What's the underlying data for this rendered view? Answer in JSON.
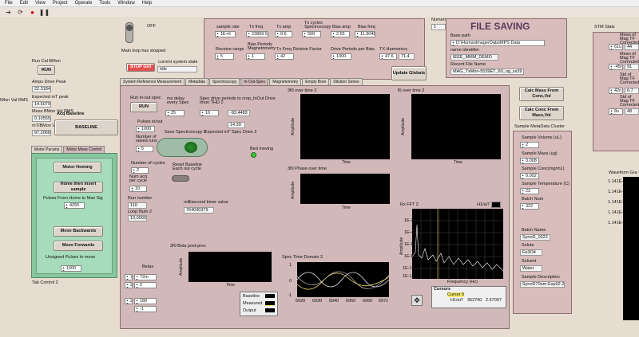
{
  "menu": [
    "File",
    "Edit",
    "View",
    "Project",
    "Operate",
    "Tools",
    "Window",
    "Help"
  ],
  "icons": [
    "run-arrow-icon",
    "run-continuous-icon",
    "abort-icon",
    "pause-icon"
  ],
  "off_label": "OFF",
  "main_loop": "Main loop has stopped",
  "stop_gui": "STOP GUI",
  "system_state": {
    "label": "current system state",
    "value": "Idle"
  },
  "numeric_tiny": {
    "label": "Numeric",
    "value": "1"
  },
  "left": {
    "run_cal_label": "Run Cal BMon",
    "run_label": "RUN",
    "amps_drive_peak": {
      "label": "Amps Drive Peak",
      "value": "22.3184"
    },
    "expected_mt_peak": {
      "label": "Expected mT peak",
      "value": "14.5079"
    },
    "imon_rms": "IMon Val RMS",
    "meas_bmon": {
      "label": "Meas BMon Val RMS",
      "value": "0.10555"
    },
    "mt_bmon": {
      "label": "mT/BMon Val",
      "value": "97.2068"
    },
    "acq_baseline": "Acq Baseline",
    "baseline_btn": "BASELINE"
  },
  "motor": {
    "tabs": [
      "Motor Params",
      "Motor Move Control"
    ],
    "homing": "Motor Homing",
    "home_insert": "Home then insert sample",
    "pulses_label": "Pulses From Home to Max Sig",
    "pulses_value": "4255",
    "move_back": "Move Backwards",
    "move_fwd": "Move Forwards",
    "unsigned_label": "Unsigned Pulses to move",
    "unsigned_value": "1000",
    "tab_control": "Tab Control 2"
  },
  "params": {
    "sample_rate": {
      "label": "sample rate",
      "value": "1E+6"
    },
    "tx_freq": {
      "label": "Tx freq",
      "value": "23809.5"
    },
    "tx_amp": {
      "label": "Tx amp",
      "value": "0.6"
    },
    "tx_cycles": {
      "label": "Tx cycles Spectroscopy",
      "value": "500"
    },
    "bias_amp": {
      "label": "Bias amp",
      "value": "2.65"
    },
    "bias_freq": {
      "label": "Bias freq",
      "value": "11.9048"
    },
    "receive_range": {
      "label": "Receive range",
      "value": "5"
    },
    "bias_periods": {
      "label": "Bias Periods Magnetometry",
      "value": "1"
    },
    "tx_div": {
      "label": "Tx Freq Division Factor",
      "value": "42"
    },
    "drive_periods": {
      "label": "Drive Periods per Bias",
      "value": "1000"
    },
    "tx_harmonics": {
      "label": "TX Harmonics",
      "v1": "47.6",
      "v2": "71.4"
    }
  },
  "file_saving": {
    "title": "FILE SAVING",
    "base_path": {
      "label": "Base path",
      "value": "D:\\HumanImagerData\\MPS Data"
    },
    "name_id": {
      "label": "name identifier",
      "value": "IEEE_MMM_DEMO"
    },
    "recent_file": {
      "label": "Recent File Name",
      "value": "MAG_TxMon-5539ET_60_ug_ss39"
    }
  },
  "update_globals": "Update Globals",
  "main_tabs": [
    "System Reference Measurement",
    "Metadata",
    "Spectroscopy",
    "In-Out-Spec",
    "Magnetometry",
    "Empty Bore",
    "Dilution Series"
  ],
  "inout": {
    "run_label": "Run in-out spec",
    "run_btn": "RUN",
    "ms_delay": {
      "label": "ms delay every Spec",
      "value": "25"
    },
    "spec_drive": {
      "label": "Spec drive periods to crop_InOut Drive Imon THD 2",
      "value": "10",
      "thd": "-93.4483"
    },
    "expected_mt": {
      "label": "Expected mT Spec Drive 2",
      "value": "14.39"
    },
    "pulses": {
      "label": "Pulses in/out",
      "value": "1000"
    },
    "saved_runs": {
      "label": "Number of saved runs",
      "value": "5"
    },
    "save_spec": "Save Spectroscopy 2",
    "bed_moving": "Bed moving",
    "cycles": {
      "label": "Number of cycles",
      "value": "2"
    },
    "acq_per": {
      "label": "Num acq per cycle",
      "value": "10"
    },
    "reset_baseline": "Reset Baseline Each out cycle",
    "run_number": {
      "label": "Run number",
      "value": "110"
    },
    "loop_num": {
      "label": "Loop Num 2",
      "value": "10,0000"
    },
    "ms_timer": {
      "label": "millisecond timer value",
      "value": "764030379"
    }
  },
  "graphs": {
    "g0": "3f0 over time 2",
    "g1": "f0 over time 2",
    "g2": "3f0 Phase over time",
    "amplitude": "Amplitude",
    "time": "Time",
    "beta": "3f0 Beta post-proc",
    "spec_td": "Spec Time Domain 2",
    "spec_x": [
      "6920",
      "6930",
      "6940",
      "6950",
      "6960",
      "6971"
    ],
    "fft": "Rx FFT 2",
    "fft_legend": "H1/ai7",
    "freq": "Frequency (Hz)",
    "fft_y": [
      "1E-2",
      "1E-4",
      "1E-6",
      "1E-8",
      "1E-10",
      "1E-12"
    ],
    "fft_x": [
      "0",
      "500000",
      "1E+6",
      "1.5E+6",
      "2E+6",
      "2.5E+6",
      "3E+6",
      "3.5E+6",
      "4E+6",
      "4.5E+6",
      "5E+6"
    ],
    "spec_y": [
      "1",
      "0.5",
      "0",
      "-0.5",
      "-1"
    ]
  },
  "betas": {
    "label": "Betas",
    "b1": "72m",
    "b2": "2",
    "b3": "180",
    "b4": "-1"
  },
  "legend": [
    "Baseline",
    "Measured",
    "Output"
  ],
  "cursors": {
    "title": "Cursors",
    "name": "Cursor 0",
    "ch": "H1/ai7",
    "x": "362790",
    "y": "2.57097"
  },
  "calc_mass": "Calc Mass From Conc,Vol",
  "calc_conc": "Calc Conc From Mass,Vol",
  "metadata": {
    "title": "Sample MetaData Cluster",
    "volume": {
      "label": "Sample Volume (uL)",
      "value": "2"
    },
    "mass": {
      "label": "Sample Mass (ug)",
      "value": "0.008"
    },
    "conc": {
      "label": "Sample Conc(mg/mL)",
      "value": "0.002"
    },
    "temp": {
      "label": "Sample Temperature (C)",
      "value": "23"
    },
    "batch_num": {
      "label": "Batch Num",
      "value": "322"
    },
    "batch_name": {
      "label": "Batch Name",
      "value": "SynoD_0222"
    },
    "solute": {
      "label": "Solute",
      "value": "Fe3O4"
    },
    "solvent": {
      "label": "Solvent",
      "value": "Water"
    },
    "desc": {
      "label": "Sample Description",
      "value": "SynoD70nm-Exp02-22"
    }
  },
  "stm": {
    "title": "STM Stats",
    "mean": "Mean of Mag TF Corrected",
    "std": "Std of Mag TF Corrected",
    "vals": [
      "61u",
      "-45m",
      "42n",
      "8u"
    ],
    "vals2": [
      "44",
      "91",
      "6.7",
      "48"
    ],
    "wf": "Waveform Gra",
    "wf_y": [
      "1.141E-",
      "1.141E-",
      "1.141E-",
      "1.141E-",
      "1.141E-",
      "1.141E-",
      "1.141E-"
    ]
  }
}
